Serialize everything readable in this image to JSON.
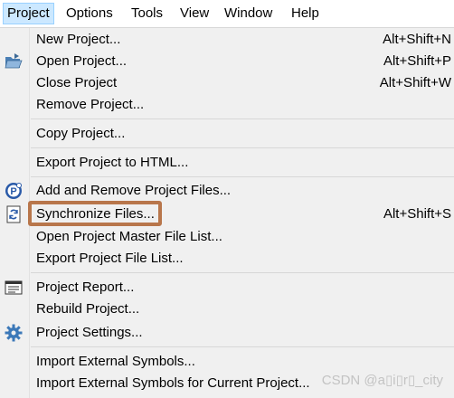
{
  "menubar": {
    "items": [
      {
        "label": "Project",
        "active": true
      },
      {
        "label": "Options"
      },
      {
        "label": "Tools"
      },
      {
        "label": "View"
      },
      {
        "label": "Window"
      },
      {
        "label": "Help"
      }
    ]
  },
  "menu": {
    "items": [
      {
        "label": "New Project...",
        "shortcut": "Alt+Shift+N"
      },
      {
        "label": "Open Project...",
        "shortcut": "Alt+Shift+P",
        "icon": "open-folder-icon"
      },
      {
        "label": "Close Project",
        "shortcut": "Alt+Shift+W"
      },
      {
        "label": "Remove Project..."
      },
      {
        "label": "Copy Project..."
      },
      {
        "label": "Export Project to HTML..."
      },
      {
        "label": "Add and Remove Project Files...",
        "icon": "project-files-icon"
      },
      {
        "label": "Synchronize Files...",
        "shortcut": "Alt+Shift+S",
        "icon": "sync-icon",
        "highlighted": true
      },
      {
        "label": "Open Project Master File List..."
      },
      {
        "label": "Export Project File List..."
      },
      {
        "label": "Project Report...",
        "icon": "report-icon"
      },
      {
        "label": "Rebuild Project..."
      },
      {
        "label": "Project Settings...",
        "icon": "gear-icon"
      },
      {
        "label": "Import External Symbols..."
      },
      {
        "label": "Import External Symbols for Current Project..."
      }
    ]
  },
  "watermark": "CSDN @a\u0000i\u0000r\u0000_city",
  "colors": {
    "menubar_bg": "#ffffff",
    "menu_bg": "#f0f0f0",
    "active_menu_bg": "#cce8ff",
    "highlight_border": "#b8764b"
  }
}
